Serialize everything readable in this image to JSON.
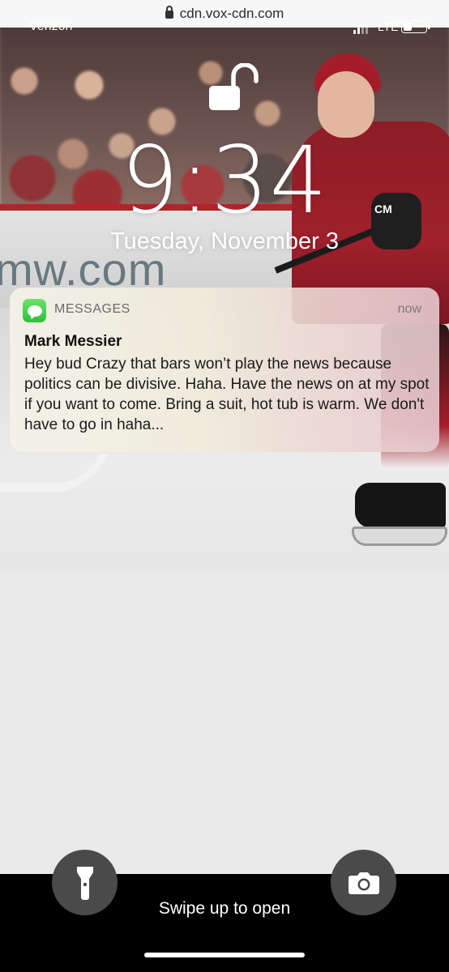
{
  "browser": {
    "url": "cdn.vox-cdn.com"
  },
  "status_bar": {
    "carrier": "Verizon",
    "network": "LTE",
    "battery_level": 0.4
  },
  "lock_screen": {
    "time": "9:34",
    "date": "Tuesday, November 3"
  },
  "wallpaper": {
    "board_ad_text": "mw.com",
    "glove_text": "CM"
  },
  "notification": {
    "app_name": "MESSAGES",
    "timestamp": "now",
    "sender": "Mark Messier",
    "body": "Hey bud Crazy that bars won’t play the news because politics can be divisive. Haha. Have the news on at my spot if you want to come. Bring a suit, hot tub is warm. We don't have to go in haha...",
    "icon": "messages-bubble-icon",
    "icon_color": "#34c759"
  },
  "bottom": {
    "swipe_label": "Swipe up to open",
    "left_icon": "flashlight-icon",
    "right_icon": "camera-icon"
  }
}
